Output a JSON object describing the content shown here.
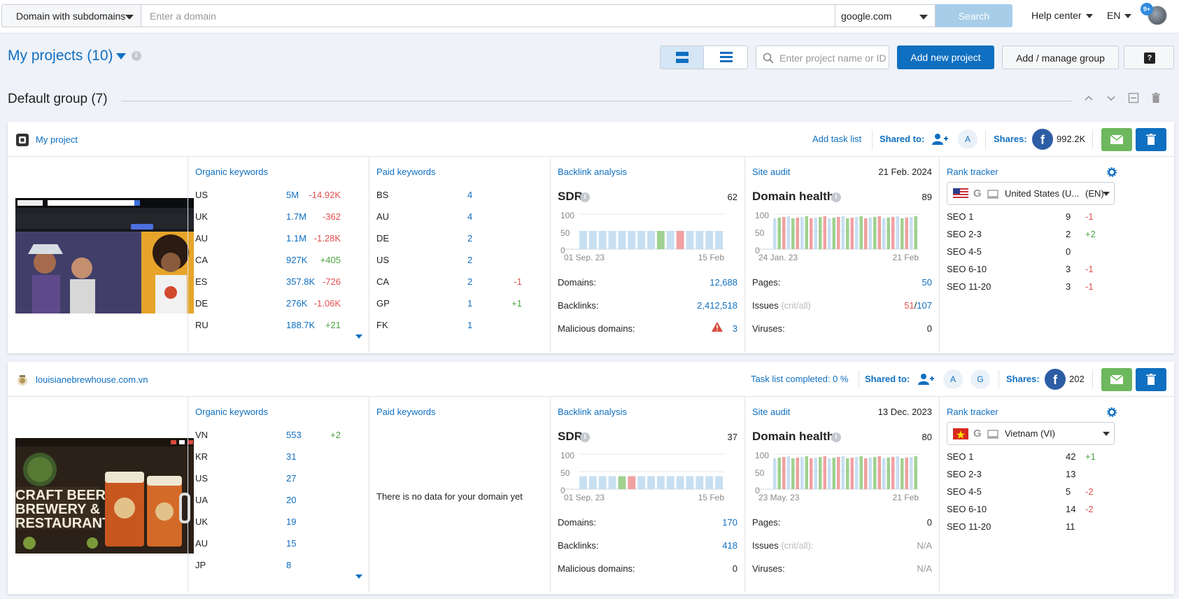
{
  "topbar": {
    "domain_mode": "Domain with subdomains",
    "domain_placeholder": "Enter a domain",
    "search_engine": "google.com",
    "search_label": "Search",
    "help_label": "Help center",
    "lang_label": "EN",
    "notif_badge": "9+"
  },
  "page": {
    "title": "My projects (10)",
    "search_placeholder": "Enter project name or ID",
    "add_project": "Add new project",
    "add_group": "Add / manage group",
    "help_q": "?"
  },
  "group": {
    "title": "Default group (7)"
  },
  "colors": {
    "accent": "#0f6fc0",
    "negative": "#e0504e",
    "positive": "#4aa33f",
    "mail": "#6db75d"
  },
  "projects": [
    {
      "name": "My project",
      "task_label": "Add task list",
      "shared_label": "Shared to:",
      "shared_users": [
        "A"
      ],
      "shares_label": "Shares:",
      "fb_icon": "f",
      "shares_value": "992.2K",
      "organic_title": "Organic keywords",
      "organic": [
        {
          "c": "US",
          "v": "5M",
          "d": "-14.92K",
          "s": "neg"
        },
        {
          "c": "UK",
          "v": "1.7M",
          "d": "-362",
          "s": "neg"
        },
        {
          "c": "AU",
          "v": "1.1M",
          "d": "-1.28K",
          "s": "neg"
        },
        {
          "c": "CA",
          "v": "927K",
          "d": "+405",
          "s": "pos"
        },
        {
          "c": "ES",
          "v": "357.8K",
          "d": "-726",
          "s": "neg"
        },
        {
          "c": "DE",
          "v": "276K",
          "d": "-1.06K",
          "s": "neg"
        },
        {
          "c": "RU",
          "v": "188.7K",
          "d": "+21",
          "s": "pos"
        }
      ],
      "paid_title": "Paid keywords",
      "paid": [
        {
          "c": "BS",
          "v": "4",
          "d": "",
          "s": ""
        },
        {
          "c": "AU",
          "v": "4",
          "d": "",
          "s": ""
        },
        {
          "c": "DE",
          "v": "2",
          "d": "",
          "s": ""
        },
        {
          "c": "US",
          "v": "2",
          "d": "",
          "s": ""
        },
        {
          "c": "CA",
          "v": "2",
          "d": "-1",
          "s": "neg"
        },
        {
          "c": "GP",
          "v": "1",
          "d": "+1",
          "s": "pos"
        },
        {
          "c": "FK",
          "v": "1",
          "d": "",
          "s": ""
        }
      ],
      "paid_empty": "",
      "backlink_title": "Backlink analysis",
      "sdr_label": "SDR",
      "sdr_value": "62",
      "bl_chart": {
        "y100": "100",
        "y50": "50",
        "y0": "0",
        "start": "01 Sep. 23",
        "end": "15 Feb",
        "bars": [
          52,
          52,
          52,
          52,
          52,
          52,
          52,
          52,
          52,
          52,
          52,
          52,
          52,
          52,
          52
        ],
        "colors": [
          "b",
          "b",
          "b",
          "b",
          "b",
          "b",
          "b",
          "b",
          "g",
          "b",
          "r",
          "b",
          "b",
          "b",
          "b"
        ]
      },
      "domains_label": "Domains:",
      "domains_value": "12,688",
      "backlinks_label": "Backlinks:",
      "backlinks_value": "2,412,518",
      "malicious_label": "Malicious domains:",
      "malicious_value": "3",
      "malicious_warn": true,
      "audit_title": "Site audit",
      "audit_date": "21 Feb. 2024",
      "health_label": "Domain health:",
      "health_value": "89",
      "audit_chart": {
        "y100": "100",
        "y50": "50",
        "y0": "0",
        "start": "24 Jan. 23",
        "end": "21 Feb"
      },
      "pages_label": "Pages:",
      "pages_value": "50",
      "issues_label": "Issues",
      "issues_hint": "(crit/all)",
      "issues_crit": "51",
      "issues_slash": "/",
      "issues_all": "107",
      "viruses_label": "Viruses:",
      "viruses_value": "0",
      "rank_title": "Rank tracker",
      "rank_region": "United States (U...",
      "rank_lang": "(EN)",
      "rank": [
        {
          "l": "SEO 1",
          "v": "9",
          "d": "-1",
          "s": "neg"
        },
        {
          "l": "SEO 2-3",
          "v": "2",
          "d": "+2",
          "s": "pos"
        },
        {
          "l": "SEO 4-5",
          "v": "0",
          "d": "",
          "s": ""
        },
        {
          "l": "SEO 6-10",
          "v": "3",
          "d": "-1",
          "s": "neg"
        },
        {
          "l": "SEO 11-20",
          "v": "3",
          "d": "-1",
          "s": "neg"
        }
      ]
    },
    {
      "name": "louisianebrewhouse.com.vn",
      "task_label": "Task list completed: 0 %",
      "shared_label": "Shared to:",
      "shared_users": [
        "A",
        "G"
      ],
      "shares_label": "Shares:",
      "fb_icon": "f",
      "shares_value": "202",
      "organic_title": "Organic keywords",
      "organic": [
        {
          "c": "VN",
          "v": "553",
          "d": "+2",
          "s": "pos"
        },
        {
          "c": "KR",
          "v": "31",
          "d": "",
          "s": ""
        },
        {
          "c": "US",
          "v": "27",
          "d": "",
          "s": ""
        },
        {
          "c": "UA",
          "v": "20",
          "d": "",
          "s": ""
        },
        {
          "c": "UK",
          "v": "19",
          "d": "",
          "s": ""
        },
        {
          "c": "AU",
          "v": "15",
          "d": "",
          "s": ""
        },
        {
          "c": "JP",
          "v": "8",
          "d": "",
          "s": ""
        }
      ],
      "paid_title": "Paid keywords",
      "paid": [],
      "paid_empty": "There is no data for your domain yet",
      "backlink_title": "Backlink analysis",
      "sdr_label": "SDR",
      "sdr_value": "37",
      "bl_chart": {
        "y100": "100",
        "y50": "50",
        "y0": "0",
        "start": "01 Sep. 23",
        "end": "15 Feb",
        "bars": [
          37,
          37,
          37,
          37,
          37,
          37,
          37,
          37,
          37,
          37,
          37,
          37,
          37,
          37,
          37
        ],
        "colors": [
          "b",
          "b",
          "b",
          "b",
          "g",
          "r",
          "b",
          "b",
          "b",
          "b",
          "b",
          "b",
          "b",
          "b",
          "b"
        ]
      },
      "domains_label": "Domains:",
      "domains_value": "170",
      "backlinks_label": "Backlinks:",
      "backlinks_value": "418",
      "malicious_label": "Malicious domains:",
      "malicious_value": "0",
      "malicious_warn": false,
      "audit_title": "Site audit",
      "audit_date": "13 Dec. 2023",
      "health_label": "Domain health:",
      "health_value": "80",
      "audit_chart": {
        "y100": "100",
        "y50": "50",
        "y0": "0",
        "start": "23 May. 23",
        "end": "21 Feb"
      },
      "pages_label": "Pages:",
      "pages_value": "0",
      "issues_label": "Issues",
      "issues_hint": "(crit/all):",
      "issues_crit": "N/A",
      "issues_slash": "",
      "issues_all": "",
      "viruses_label": "Viruses:",
      "viruses_value": "N/A",
      "rank_title": "Rank tracker",
      "rank_region": "Vietnam (VI)",
      "rank_lang": "",
      "rank": [
        {
          "l": "SEO 1",
          "v": "42",
          "d": "+1",
          "s": "pos"
        },
        {
          "l": "SEO 2-3",
          "v": "13",
          "d": "",
          "s": ""
        },
        {
          "l": "SEO 4-5",
          "v": "5",
          "d": "-2",
          "s": "neg"
        },
        {
          "l": "SEO 6-10",
          "v": "14",
          "d": "-2",
          "s": "neg"
        },
        {
          "l": "SEO 11-20",
          "v": "11",
          "d": "",
          "s": ""
        }
      ]
    }
  ]
}
